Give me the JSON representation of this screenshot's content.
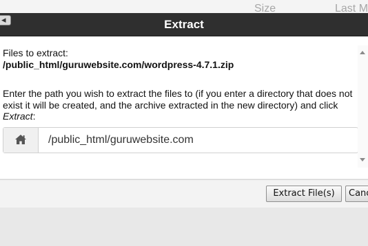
{
  "background": {
    "columns": [
      "Size",
      "Last M"
    ]
  },
  "modal": {
    "title": "Extract",
    "close_glyph": "◂",
    "files_label": "Files to extract:",
    "files_path": "/public_html/guruwebsite.com/wordpress-4.7.1.zip",
    "instructions_text": "Enter the path you wish to extract the files to (if you enter a directory that does not exist it will be created, and the archive extracted in the new directory) and click ",
    "instructions_emphasis": "Extract",
    "instructions_end": ":",
    "path_icon": "home-icon",
    "path_value": "/public_html/guruwebsite.com",
    "buttons": {
      "extract": "Extract File(s)",
      "cancel": "Cancel"
    }
  },
  "colors": {
    "titlebar": "#2f2f2f",
    "title_text": "#ffffff",
    "body": "#ffffff",
    "footer": "#f3f3f3"
  }
}
